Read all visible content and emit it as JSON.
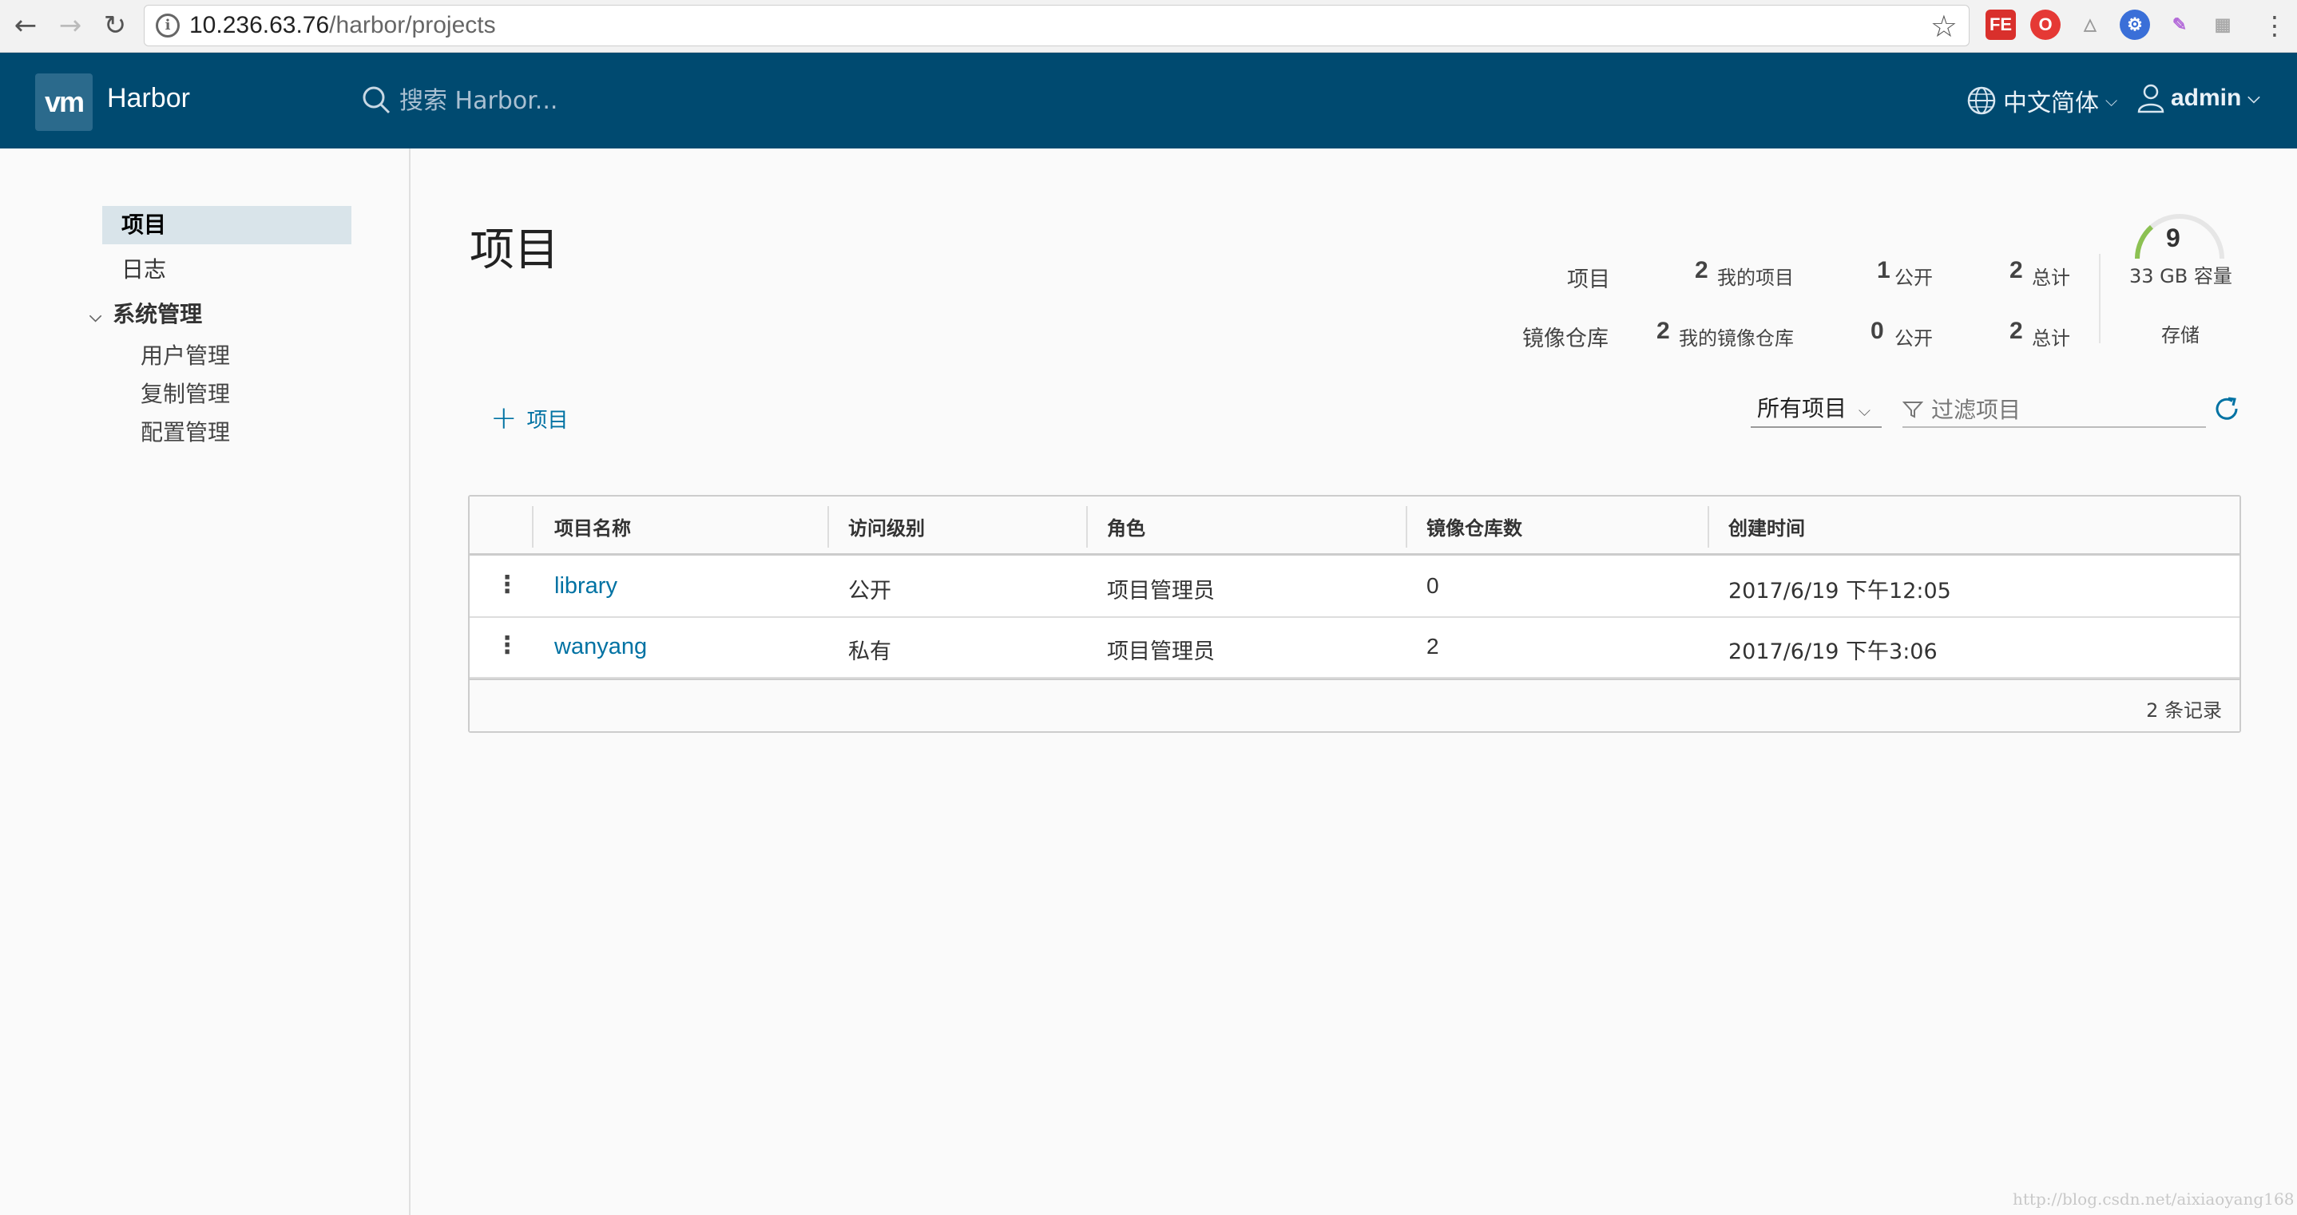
{
  "browser": {
    "url_host": "10.236.63.76",
    "url_path": "/harbor/projects"
  },
  "header": {
    "logo_text": "vm",
    "brand": "Harbor",
    "search_placeholder": "搜索 Harbor...",
    "language": "中文简体",
    "user": "admin"
  },
  "sidebar": {
    "items": [
      {
        "label": "项目"
      },
      {
        "label": "日志"
      },
      {
        "label": "系统管理"
      }
    ],
    "admin_sub": [
      {
        "label": "用户管理"
      },
      {
        "label": "复制管理"
      },
      {
        "label": "配置管理"
      }
    ]
  },
  "main": {
    "title": "项目",
    "stats": {
      "projects_label": "项目",
      "repos_label": "镜像仓库",
      "projects_mine": "2",
      "projects_mine_txt": "我的项目",
      "projects_public": "1",
      "projects_public_txt": "公开",
      "projects_total": "2",
      "projects_total_txt": "总计",
      "repos_mine": "2",
      "repos_mine_txt": "我的镜像仓库",
      "repos_public": "0",
      "repos_public_txt": "公开",
      "repos_total": "2",
      "repos_total_txt": "总计",
      "storage_used": "9",
      "storage_capacity": "33 GB 容量",
      "storage_label": "存储",
      "storage_fraction": 0.27
    },
    "add_project_label": "项目",
    "filter_select": "所有项目",
    "filter_placeholder": "过滤项目",
    "table": {
      "headers": [
        "项目名称",
        "访问级别",
        "角色",
        "镜像仓库数",
        "创建时间"
      ],
      "rows": [
        {
          "name": "library",
          "access": "公开",
          "role": "项目管理员",
          "repos": "0",
          "created": "2017/6/19 下午12:05"
        },
        {
          "name": "wanyang",
          "access": "私有",
          "role": "项目管理员",
          "repos": "2",
          "created": "2017/6/19 下午3:06"
        }
      ],
      "footer": "2 条记录"
    }
  },
  "watermark": "http://blog.csdn.net/aixiaoyang168",
  "colors": {
    "header_bg": "#004a70",
    "link": "#0072a3",
    "active_sidebar": "#d9e4ea",
    "gauge": "#8cc152"
  }
}
